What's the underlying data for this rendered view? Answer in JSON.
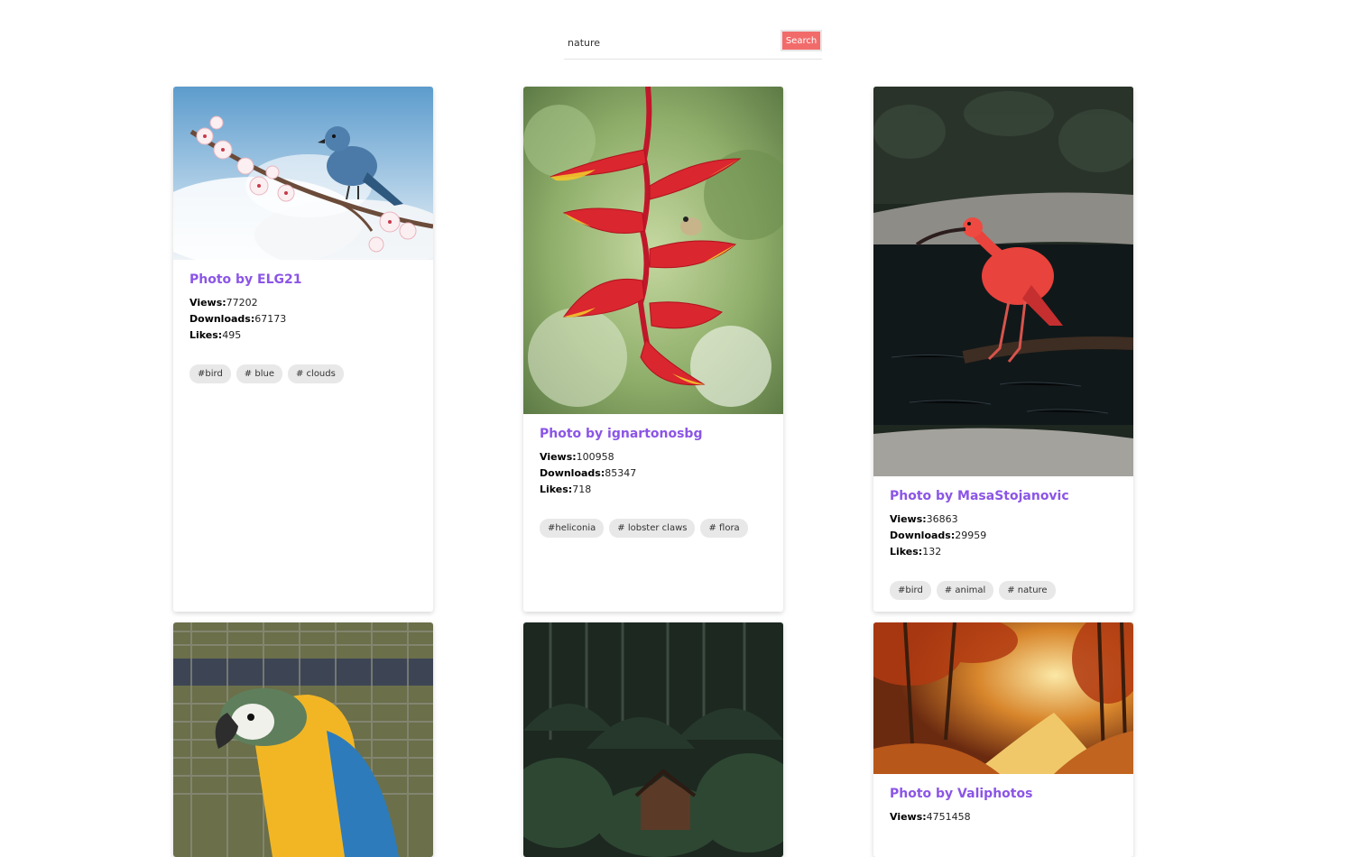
{
  "search": {
    "value": "nature",
    "button_label": "Search"
  },
  "stat_labels": {
    "views": "Views:",
    "downloads": "Downloads:",
    "likes": "Likes:"
  },
  "cards": [
    {
      "title": "Photo by ELG21",
      "views": "77202",
      "downloads": "67173",
      "likes": "495",
      "tags": [
        "#bird",
        "# blue",
        "# clouds"
      ],
      "image": "bird-on-blossom-image"
    },
    {
      "title": "Photo by ignartonosbg",
      "views": "100958",
      "downloads": "85347",
      "likes": "718",
      "tags": [
        "#heliconia",
        "# lobster claws",
        "# flora"
      ],
      "image": "heliconia-flower-image"
    },
    {
      "title": "Photo by MasaStojanovic",
      "views": "36863",
      "downloads": "29959",
      "likes": "132",
      "tags": [
        "#bird",
        "# animal",
        "# nature"
      ],
      "image": "scarlet-ibis-image"
    },
    {
      "image": "macaw-parrot-image"
    },
    {
      "image": "forest-cabin-image"
    },
    {
      "title": "Photo by Valiphotos",
      "views": "4751458",
      "image": "autumn-path-image"
    }
  ]
}
